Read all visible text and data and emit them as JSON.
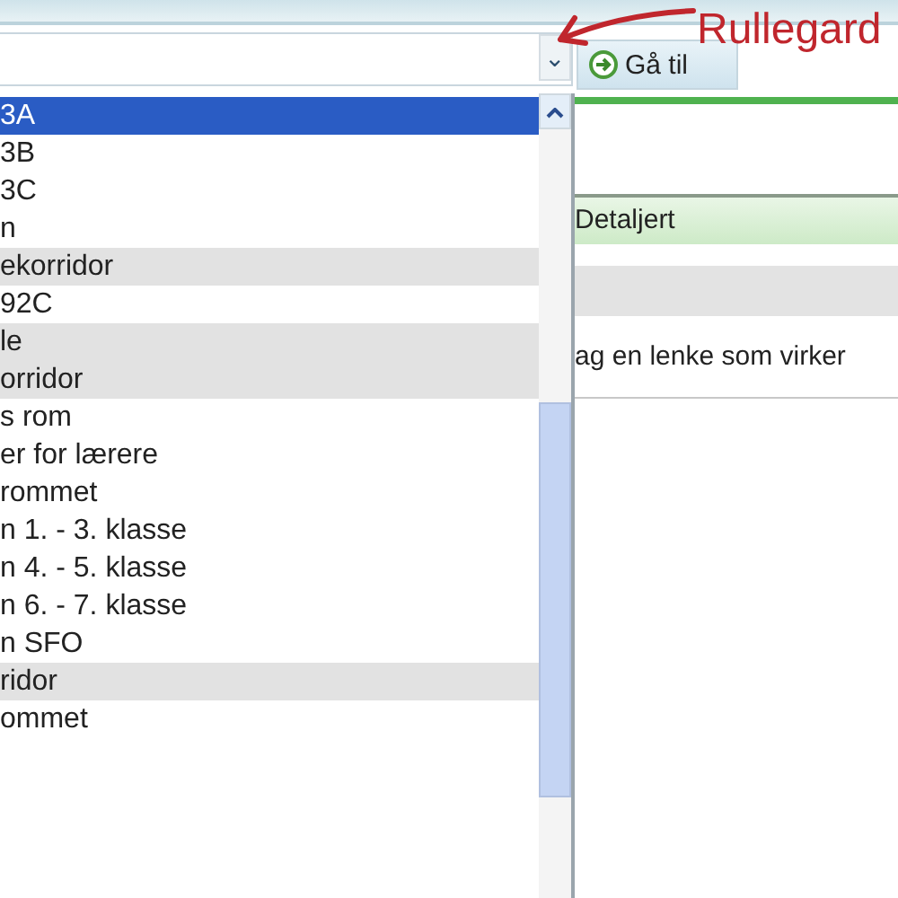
{
  "combo": {
    "caret": "⌄"
  },
  "go_button": {
    "label": "Gå til"
  },
  "annotation": {
    "label": "Rullegard"
  },
  "dropdown": {
    "items": [
      {
        "label": "3A",
        "selected": true,
        "shaded": false
      },
      {
        "label": "3B",
        "selected": false,
        "shaded": false
      },
      {
        "label": "3C",
        "selected": false,
        "shaded": false
      },
      {
        "label": "n",
        "selected": false,
        "shaded": false
      },
      {
        "label": "ekorridor",
        "selected": false,
        "shaded": true
      },
      {
        "label": "92C",
        "selected": false,
        "shaded": false
      },
      {
        "label": "le",
        "selected": false,
        "shaded": true
      },
      {
        "label": "orridor",
        "selected": false,
        "shaded": true
      },
      {
        "label": "s rom",
        "selected": false,
        "shaded": false
      },
      {
        "label": "er for lærere",
        "selected": false,
        "shaded": false
      },
      {
        "label": "rommet",
        "selected": false,
        "shaded": false
      },
      {
        "label": "n 1. - 3. klasse",
        "selected": false,
        "shaded": false
      },
      {
        "label": "n 4. - 5. klasse",
        "selected": false,
        "shaded": false
      },
      {
        "label": "n 6. - 7. klasse",
        "selected": false,
        "shaded": false
      },
      {
        "label": "n SFO",
        "selected": false,
        "shaded": false
      },
      {
        "label": "ridor",
        "selected": false,
        "shaded": true
      },
      {
        "label": "ommet",
        "selected": false,
        "shaded": false
      }
    ]
  },
  "panel": {
    "header": "Detaljert",
    "text": "ag en lenke som virker"
  }
}
